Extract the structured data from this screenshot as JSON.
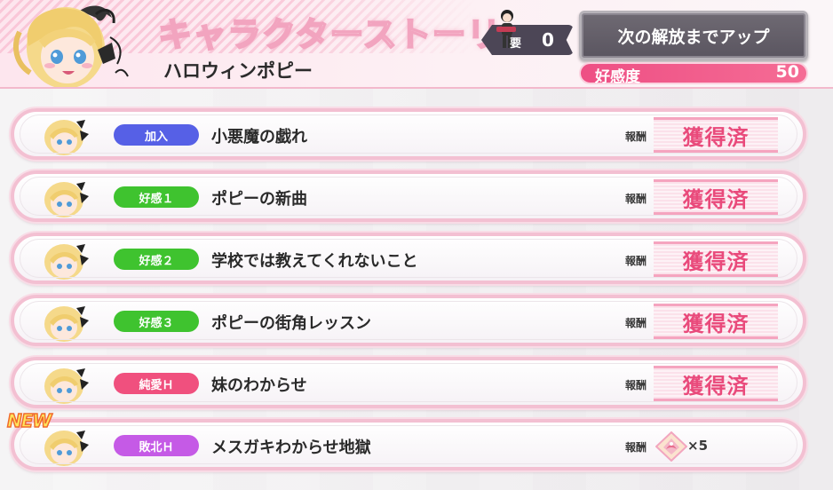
{
  "header": {
    "title": "キャラクターストーリー",
    "character_name": "ハロウィンポピー",
    "requirement": {
      "label": "要",
      "value": "0"
    },
    "unlock_button_label": "次の解放までアップ",
    "affinity": {
      "label": "好感度",
      "value": "50"
    }
  },
  "stories": [
    {
      "badge": "加入",
      "badge_color": "#5660e6",
      "title": "小悪魔の戯れ",
      "reward_label": "報酬",
      "reward": "獲得済"
    },
    {
      "badge": "好感１",
      "badge_color": "#3fc32f",
      "title": "ポピーの新曲",
      "reward_label": "報酬",
      "reward": "獲得済"
    },
    {
      "badge": "好感２",
      "badge_color": "#3fc32f",
      "title": "学校では教えてくれないこと",
      "reward_label": "報酬",
      "reward": "獲得済"
    },
    {
      "badge": "好感３",
      "badge_color": "#3fc32f",
      "title": "ポピーの街角レッスン",
      "reward_label": "報酬",
      "reward": "獲得済"
    },
    {
      "badge": "純愛Ｈ",
      "badge_color": "#f0507e",
      "title": "妹のわからせ",
      "reward_label": "報酬",
      "reward": "獲得済"
    },
    {
      "badge": "敗北Ｈ",
      "badge_color": "#c55ae6",
      "title": "メスガキわからせ地獄",
      "reward_label": "報酬",
      "reward_count": "×5",
      "reward_icon": "crystal-icon",
      "new_label": "NEW"
    }
  ],
  "colors": {
    "accent_pink": "#ee4f84",
    "stamp_pink": "#e94a7b",
    "row_border": "#f3c0d2"
  }
}
